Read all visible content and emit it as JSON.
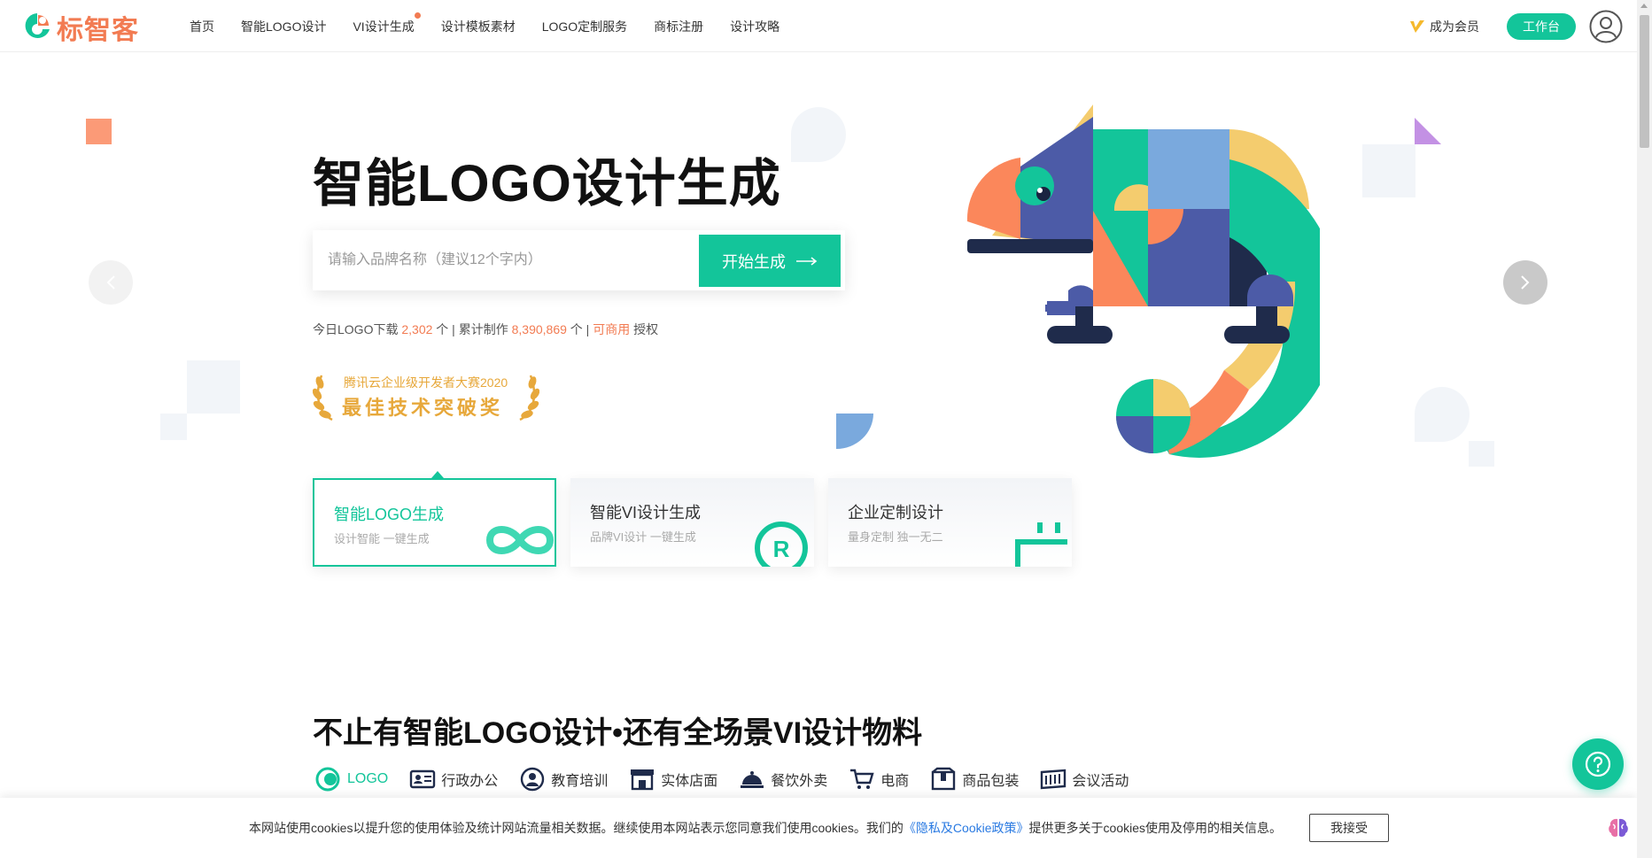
{
  "brand": {
    "name": "标智客",
    "accent": "#13c59a",
    "orange": "#f27b52"
  },
  "nav": [
    {
      "label": "首页"
    },
    {
      "label": "智能LOGO设计"
    },
    {
      "label": "VI设计生成"
    },
    {
      "label": "设计模板素材"
    },
    {
      "label": "LOGO定制服务"
    },
    {
      "label": "商标注册"
    },
    {
      "label": "设计攻略"
    }
  ],
  "header": {
    "member_label": "成为会员",
    "workbench_label": "工作台",
    "avatar_icon": "user-avatar-icon"
  },
  "hero": {
    "title": "智能LOGO设计生成",
    "search_placeholder": "请输入品牌名称（建议12个字内）",
    "start_label": "开始生成",
    "stats": {
      "today_prefix": "今日LOGO下载",
      "today_value": "2,302",
      "today_unit": "个 |",
      "total_prefix": "累计制作",
      "total_value": "8,390,869",
      "total_unit": "个 |",
      "commercial": "可商用",
      "license": "授权"
    },
    "award": {
      "sub": "腾讯云企业级开发者大赛2020",
      "main": "最佳技术突破奖"
    }
  },
  "cards": [
    {
      "title": "智能LOGO生成",
      "sub": "设计智能 一键生成"
    },
    {
      "title": "智能VI设计生成",
      "sub": "品牌VI设计 一键生成"
    },
    {
      "title": "企业定制设计",
      "sub": "量身定制 独一无二"
    }
  ],
  "section": {
    "title": "不止有智能LOGO设计•还有全场景VI设计物料",
    "categories": [
      {
        "label": "LOGO",
        "icon": "logo-icon"
      },
      {
        "label": "行政办公",
        "icon": "id-card-icon"
      },
      {
        "label": "教育培训",
        "icon": "teacher-icon"
      },
      {
        "label": "实体店面",
        "icon": "storefront-icon"
      },
      {
        "label": "餐饮外卖",
        "icon": "food-cloche-icon"
      },
      {
        "label": "电商",
        "icon": "cart-icon"
      },
      {
        "label": "商品包装",
        "icon": "package-icon"
      },
      {
        "label": "会议活动",
        "icon": "banner-icon"
      }
    ]
  },
  "cookie": {
    "text_before": "本网站使用cookies以提升您的使用体验及统计网站流量相关数据。继续使用本网站表示您同意我们使用cookies。我们的",
    "policy_link": "《隐私及Cookie政策》",
    "text_after": "提供更多关于cookies使用及停用的相关信息。",
    "accept_label": "我接受"
  }
}
